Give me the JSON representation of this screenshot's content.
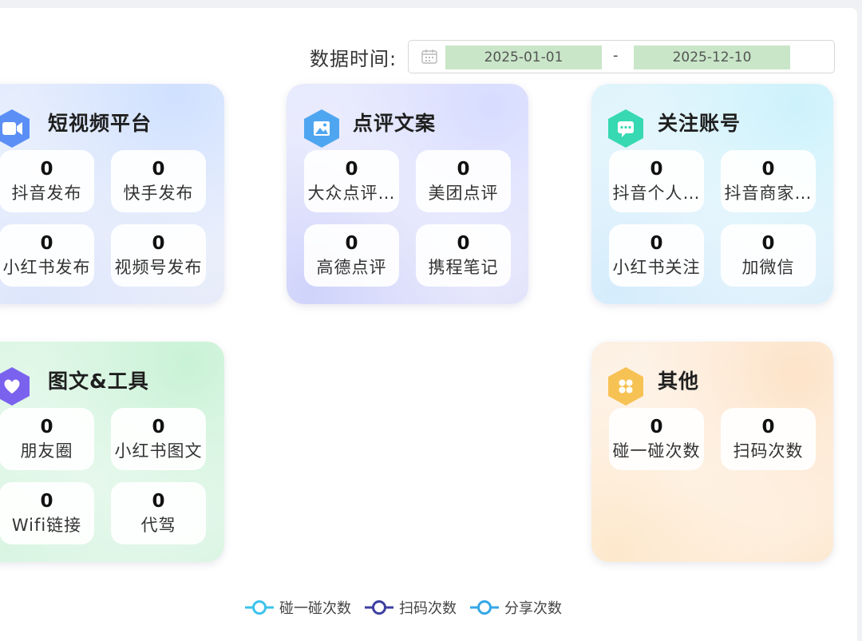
{
  "filter": {
    "label": "数据时间:",
    "start_date": "2025-01-01",
    "separator": "-",
    "end_date": "2025-12-10"
  },
  "cards": {
    "short_video": {
      "title": "短视频平台",
      "icon": "video-camera-icon",
      "stats": [
        {
          "value": "0",
          "label": "抖音发布"
        },
        {
          "value": "0",
          "label": "快手发布"
        },
        {
          "value": "0",
          "label": "小红书发布"
        },
        {
          "value": "0",
          "label": "视频号发布"
        }
      ]
    },
    "reviews": {
      "title": "点评文案",
      "icon": "image-icon",
      "stats": [
        {
          "value": "0",
          "label": "大众点评…"
        },
        {
          "value": "0",
          "label": "美团点评"
        },
        {
          "value": "0",
          "label": "高德点评"
        },
        {
          "value": "0",
          "label": "携程笔记"
        }
      ]
    },
    "follow": {
      "title": "关注账号",
      "icon": "chat-bubble-icon",
      "stats": [
        {
          "value": "0",
          "label": "抖音个人…"
        },
        {
          "value": "0",
          "label": "抖音商家…"
        },
        {
          "value": "0",
          "label": "小红书关注"
        },
        {
          "value": "0",
          "label": "加微信"
        }
      ]
    },
    "graphic_tools": {
      "title": "图文&工具",
      "icon": "heart-icon",
      "stats": [
        {
          "value": "0",
          "label": "朋友圈"
        },
        {
          "value": "0",
          "label": "小红书图文"
        },
        {
          "value": "0",
          "label": "Wifi链接"
        },
        {
          "value": "0",
          "label": "代驾"
        }
      ]
    },
    "other": {
      "title": "其他",
      "icon": "grid-icon",
      "stats": [
        {
          "value": "0",
          "label": "碰一碰次数"
        },
        {
          "value": "0",
          "label": "扫码次数"
        }
      ]
    }
  },
  "legend": [
    {
      "label": "碰一碰次数",
      "color": "#3cc3ec"
    },
    {
      "label": "扫码次数",
      "color": "#3d3fa0"
    },
    {
      "label": "分享次数",
      "color": "#35a7e6"
    }
  ]
}
